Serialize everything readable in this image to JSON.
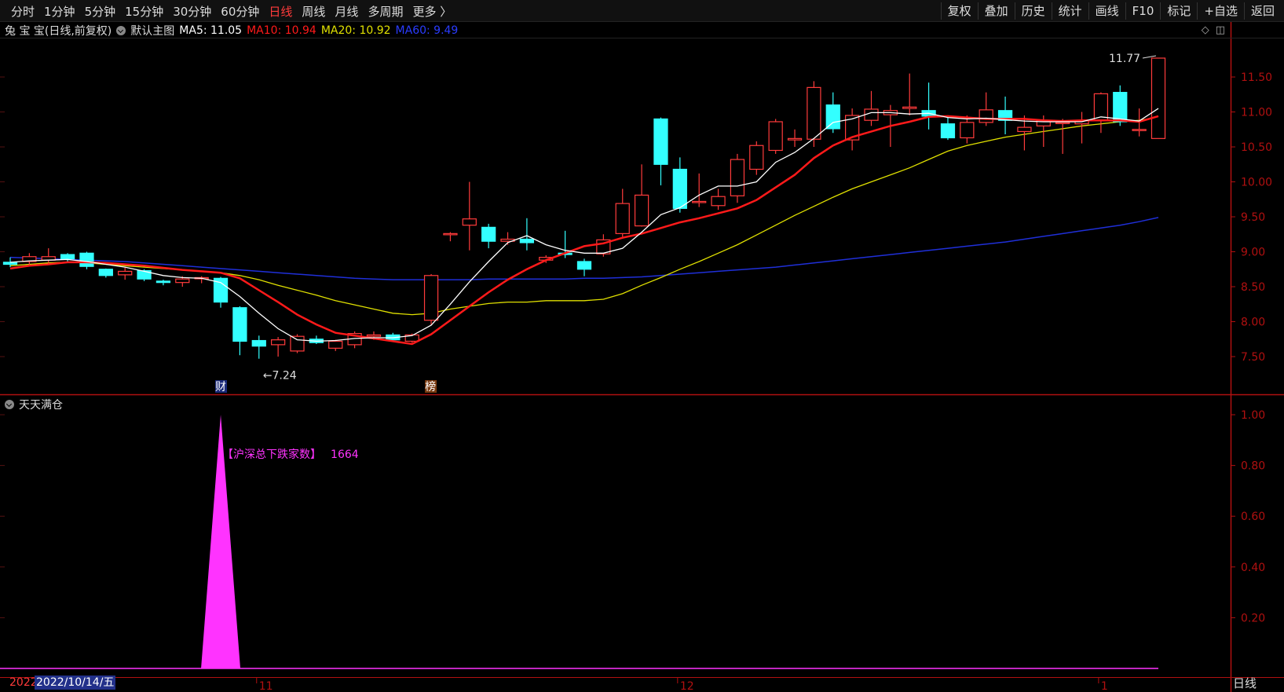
{
  "toolbar": {
    "periods": [
      "分时",
      "1分钟",
      "5分钟",
      "15分钟",
      "30分钟",
      "60分钟",
      "日线",
      "周线",
      "月线",
      "多周期",
      "更多 〉"
    ],
    "active_period": "日线",
    "right_buttons": [
      "复权",
      "叠加",
      "历史",
      "统计",
      "画线",
      "F10",
      "标记",
      "+自选",
      "返回"
    ]
  },
  "header": {
    "stock_name": "兔 宝 宝(日线,前复权)",
    "template": "默认主图",
    "ma5": "MA5: 11.05",
    "ma10": "MA10: 10.94",
    "ma20": "MA20: 10.92",
    "ma60": "MA60: 9.49"
  },
  "colors": {
    "up": "#ff3b3b",
    "down": "#33ffff",
    "ma5": "#ffffff",
    "ma10": "#ff1a1a",
    "ma20": "#e0e000",
    "ma60": "#1f2fd8",
    "indicator": "#ff33ff",
    "axis": "#b01010"
  },
  "chart_data": {
    "type": "candlestick",
    "ylim": [
      7.2,
      11.8
    ],
    "y_ticks": [
      "11.50",
      "11.00",
      "10.50",
      "10.00",
      "9.50",
      "9.00",
      "8.50",
      "8.00",
      "7.50"
    ],
    "annotations": {
      "high_label": "11.77",
      "low_label": "←7.24",
      "marker_cai": "财",
      "marker_bang": "榜"
    },
    "x_ticks": [
      "11",
      "12",
      "1"
    ],
    "candles": [
      [
        8.85,
        8.82,
        8.92,
        8.78
      ],
      [
        8.86,
        8.93,
        8.98,
        8.8
      ],
      [
        8.88,
        8.93,
        9.05,
        8.82
      ],
      [
        8.96,
        8.9,
        8.98,
        8.85
      ],
      [
        8.98,
        8.79,
        9.0,
        8.75
      ],
      [
        8.75,
        8.66,
        8.76,
        8.63
      ],
      [
        8.67,
        8.72,
        8.78,
        8.6
      ],
      [
        8.73,
        8.61,
        8.75,
        8.58
      ],
      [
        8.58,
        8.56,
        8.6,
        8.52
      ],
      [
        8.56,
        8.61,
        8.65,
        8.5
      ],
      [
        8.62,
        8.63,
        8.65,
        8.55
      ],
      [
        8.62,
        8.28,
        8.64,
        8.2
      ],
      [
        8.2,
        7.72,
        8.22,
        7.52
      ],
      [
        7.73,
        7.65,
        7.8,
        7.47
      ],
      [
        7.67,
        7.74,
        7.78,
        7.5
      ],
      [
        7.58,
        7.79,
        7.82,
        7.55
      ],
      [
        7.75,
        7.7,
        7.8,
        7.68
      ],
      [
        7.62,
        7.72,
        7.74,
        7.58
      ],
      [
        7.67,
        7.83,
        7.86,
        7.62
      ],
      [
        7.79,
        7.81,
        7.86,
        7.74
      ],
      [
        7.81,
        7.74,
        7.84,
        7.73
      ],
      [
        7.72,
        7.81,
        7.83,
        7.7
      ],
      [
        8.02,
        8.66,
        8.68,
        7.95
      ],
      [
        9.26,
        9.26,
        9.28,
        9.15
      ],
      [
        9.38,
        9.47,
        10.0,
        9.02
      ],
      [
        9.35,
        9.15,
        9.4,
        9.05
      ],
      [
        9.15,
        9.18,
        9.28,
        9.1
      ],
      [
        9.18,
        9.13,
        9.48,
        9.02
      ],
      [
        8.88,
        8.92,
        8.95,
        8.84
      ],
      [
        8.98,
        8.96,
        9.3,
        8.91
      ],
      [
        8.86,
        8.75,
        8.9,
        8.65
      ],
      [
        8.97,
        9.17,
        9.25,
        8.93
      ],
      [
        9.26,
        9.69,
        9.9,
        9.2
      ],
      [
        9.37,
        9.81,
        10.25,
        9.36
      ],
      [
        10.9,
        10.25,
        10.92,
        9.95
      ],
      [
        10.18,
        9.62,
        10.35,
        9.56
      ],
      [
        9.72,
        9.72,
        10.12,
        9.64
      ],
      [
        9.66,
        9.79,
        9.9,
        9.6
      ],
      [
        9.8,
        10.32,
        10.4,
        9.7
      ],
      [
        10.18,
        10.52,
        10.58,
        10.1
      ],
      [
        10.45,
        10.86,
        10.9,
        10.4
      ],
      [
        10.6,
        10.62,
        10.75,
        10.5
      ],
      [
        10.61,
        11.35,
        11.44,
        10.5
      ],
      [
        11.1,
        10.76,
        11.28,
        10.7
      ],
      [
        10.6,
        10.95,
        11.05,
        10.45
      ],
      [
        10.88,
        11.04,
        11.3,
        10.8
      ],
      [
        10.96,
        11.02,
        11.1,
        10.5
      ],
      [
        11.05,
        11.07,
        11.55,
        10.95
      ],
      [
        11.02,
        10.94,
        11.42,
        10.75
      ],
      [
        10.83,
        10.63,
        10.95,
        10.6
      ],
      [
        10.63,
        10.85,
        10.95,
        10.55
      ],
      [
        10.85,
        11.03,
        11.28,
        10.8
      ],
      [
        11.02,
        10.88,
        11.22,
        10.68
      ],
      [
        10.72,
        10.78,
        10.95,
        10.45
      ],
      [
        10.8,
        10.88,
        10.95,
        10.5
      ],
      [
        10.85,
        10.85,
        10.9,
        10.4
      ],
      [
        10.83,
        10.88,
        11.0,
        10.55
      ],
      [
        10.88,
        11.26,
        11.28,
        10.7
      ],
      [
        11.28,
        10.86,
        11.38,
        10.8
      ],
      [
        10.75,
        10.75,
        11.05,
        10.65
      ],
      [
        10.62,
        11.77,
        11.77,
        10.62
      ]
    ],
    "ma5": [
      8.85,
      8.87,
      8.88,
      8.89,
      8.86,
      8.82,
      8.78,
      8.72,
      8.66,
      8.63,
      8.62,
      8.56,
      8.36,
      8.12,
      7.9,
      7.74,
      7.72,
      7.73,
      7.76,
      7.77,
      7.77,
      7.8,
      7.95,
      8.25,
      8.57,
      8.86,
      9.13,
      9.23,
      9.1,
      9.02,
      8.98,
      8.98,
      9.05,
      9.28,
      9.53,
      9.63,
      9.81,
      9.94,
      9.94,
      10.0,
      10.28,
      10.42,
      10.62,
      10.85,
      10.9,
      10.99,
      10.99,
      10.97,
      10.98,
      10.92,
      10.9,
      10.91,
      10.89,
      10.87,
      10.86,
      10.86,
      10.86,
      10.93,
      10.9,
      10.87,
      11.05
    ],
    "ma10": [
      8.76,
      8.8,
      8.82,
      8.85,
      8.85,
      8.84,
      8.82,
      8.8,
      8.77,
      8.74,
      8.72,
      8.7,
      8.62,
      8.45,
      8.28,
      8.1,
      7.96,
      7.84,
      7.8,
      7.76,
      7.72,
      7.68,
      7.82,
      8.02,
      8.22,
      8.42,
      8.6,
      8.75,
      8.88,
      8.98,
      9.08,
      9.12,
      9.2,
      9.26,
      9.34,
      9.42,
      9.48,
      9.55,
      9.62,
      9.74,
      9.92,
      10.1,
      10.34,
      10.52,
      10.64,
      10.72,
      10.8,
      10.86,
      10.93,
      10.94,
      10.92,
      10.9,
      10.9,
      10.9,
      10.88,
      10.87,
      10.88,
      10.88,
      10.88,
      10.86,
      10.94
    ],
    "ma20": [
      8.8,
      8.82,
      8.84,
      8.85,
      8.84,
      8.82,
      8.8,
      8.78,
      8.76,
      8.74,
      8.72,
      8.7,
      8.66,
      8.6,
      8.52,
      8.45,
      8.38,
      8.3,
      8.24,
      8.18,
      8.12,
      8.1,
      8.12,
      8.18,
      8.22,
      8.26,
      8.28,
      8.28,
      8.3,
      8.3,
      8.3,
      8.32,
      8.4,
      8.52,
      8.63,
      8.75,
      8.86,
      8.98,
      9.1,
      9.24,
      9.38,
      9.52,
      9.65,
      9.78,
      9.9,
      10.0,
      10.1,
      10.2,
      10.32,
      10.44,
      10.52,
      10.58,
      10.64,
      10.68,
      10.72,
      10.76,
      10.8,
      10.83,
      10.86,
      10.88,
      10.92
    ],
    "ma60": [
      8.92,
      8.91,
      8.9,
      8.89,
      8.88,
      8.87,
      8.86,
      8.84,
      8.82,
      8.8,
      8.78,
      8.76,
      8.74,
      8.72,
      8.7,
      8.68,
      8.66,
      8.64,
      8.62,
      8.61,
      8.6,
      8.6,
      8.6,
      8.6,
      8.6,
      8.61,
      8.61,
      8.61,
      8.61,
      8.61,
      8.62,
      8.62,
      8.63,
      8.64,
      8.66,
      8.68,
      8.7,
      8.72,
      8.74,
      8.76,
      8.78,
      8.81,
      8.84,
      8.87,
      8.9,
      8.93,
      8.96,
      8.99,
      9.02,
      9.05,
      9.08,
      9.11,
      9.14,
      9.18,
      9.22,
      9.26,
      9.3,
      9.34,
      9.38,
      9.43,
      9.49
    ]
  },
  "indicator": {
    "name": "天天满仓",
    "label": "【沪深总下跌家数】",
    "value": "1664",
    "y_ticks": [
      "1.00",
      "0.80",
      "0.60",
      "0.40",
      "0.20"
    ],
    "ylim": [
      0,
      1.05
    ],
    "spike_index": 11,
    "spike_value": 1.0
  },
  "footer": {
    "year": "2022",
    "date": "2022/10/14/五",
    "period_label": "日线"
  }
}
